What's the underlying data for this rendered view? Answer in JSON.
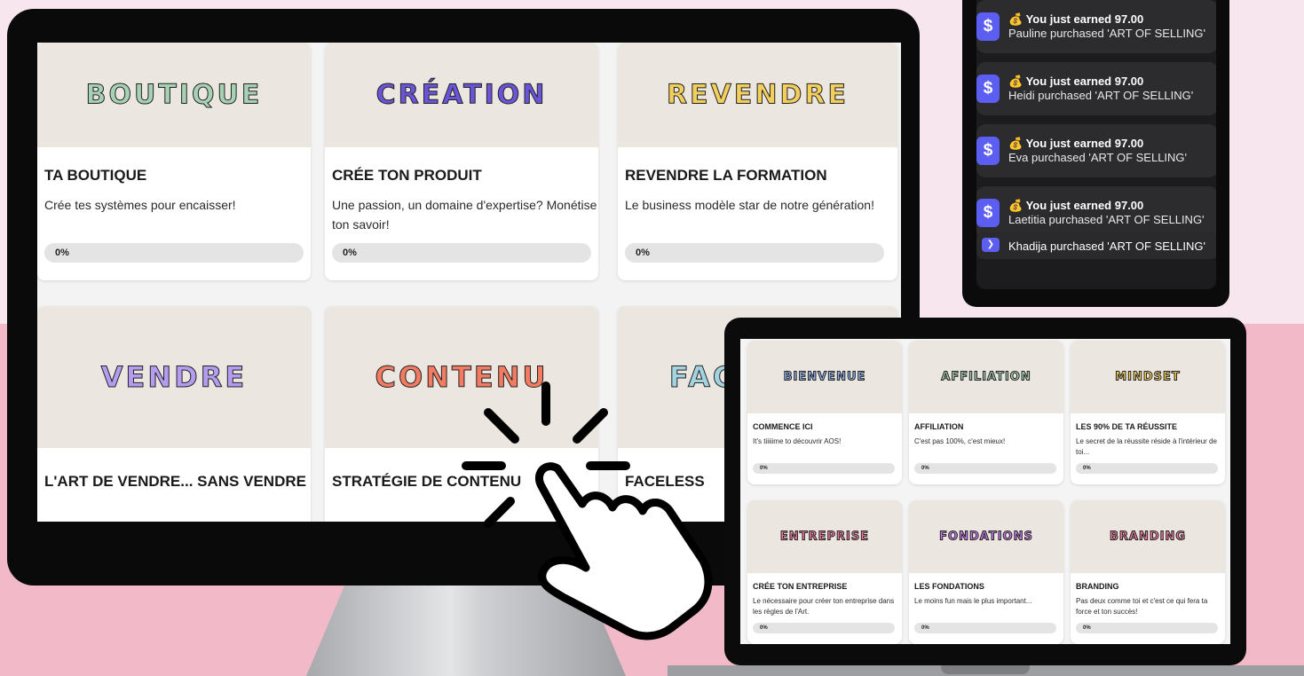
{
  "imac_cards_row1": [
    {
      "watermark": "BOUTIQUE",
      "wm_color": "#a7d1b4",
      "title": "TA BOUTIQUE",
      "desc": "Crée tes systèmes pour encaisser!",
      "progress": "0%"
    },
    {
      "watermark": "CRÉATION",
      "wm_color": "#6a54d8",
      "title": "CRÉE TON PRODUIT",
      "desc": "Une passion, un domaine d'expertise? Monétise ton savoir!",
      "progress": "0%"
    },
    {
      "watermark": "REVENDRE",
      "wm_color": "#f2cf5c",
      "title": "REVENDRE LA FORMATION",
      "desc": "Le business modèle star de notre génération!",
      "progress": "0%"
    }
  ],
  "imac_cards_row2": [
    {
      "watermark": "VENDRE",
      "wm_color": "#b49cf0",
      "title": "L'ART DE VENDRE... SANS VENDRE"
    },
    {
      "watermark": "CONTENU",
      "wm_color": "#f27b62",
      "title": "STRATÉGIE DE CONTENU"
    },
    {
      "watermark": "FACELESS",
      "wm_color": "#a2d3e0",
      "title": "FACELESS"
    }
  ],
  "phone_notifications": [
    {
      "earned": "💰 You just earned   97.00",
      "buyer": "Pauline purchased 'ART OF SELLING'"
    },
    {
      "earned": "💰 You just earned   97.00",
      "buyer": "Heidi purchased 'ART OF SELLING'"
    },
    {
      "earned": "💰 You just earned   97.00",
      "buyer": "Eva purchased 'ART OF SELLING'"
    },
    {
      "earned": "💰 You just earned   97.00",
      "buyer": "Laetitia purchased 'ART OF SELLING'"
    }
  ],
  "phone_tail": "Khadija purchased 'ART OF SELLING'",
  "laptop_cards": [
    {
      "watermark": "BIENVENUE",
      "wm_color": "#8fb2f0",
      "title": "COMMENCE ICI",
      "desc": "It's tiiiiime to découvrir AOS!",
      "progress": "0%"
    },
    {
      "watermark": "AFFILIATION",
      "wm_color": "#a7d1b4",
      "title": "AFFILIATION",
      "desc": "C'est pas 100%, c'est mieux!",
      "progress": "0%"
    },
    {
      "watermark": "MINDSET",
      "wm_color": "#f2cf5c",
      "title": "LES 90% DE TA RÉUSSITE",
      "desc": "Le secret de la réussite réside à l'intérieur de toi...",
      "progress": "0%"
    },
    {
      "watermark": "ENTREPRISE",
      "wm_color": "#f07aa0",
      "title": "CRÉE TON ENTREPRISE",
      "desc": "Le nécessaire pour créer ton entreprise dans les règles de l'Art.",
      "progress": "0%"
    },
    {
      "watermark": "FONDATIONS",
      "wm_color": "#c77df0",
      "title": "LES FONDATIONS",
      "desc": "Le moins fun mais le plus important...",
      "progress": "0%"
    },
    {
      "watermark": "BRANDING",
      "wm_color": "#f07aa0",
      "title": "BRANDING",
      "desc": "Pas deux comme toi et c'est ce qui fera ta force et ton succès!",
      "progress": "0%"
    }
  ]
}
